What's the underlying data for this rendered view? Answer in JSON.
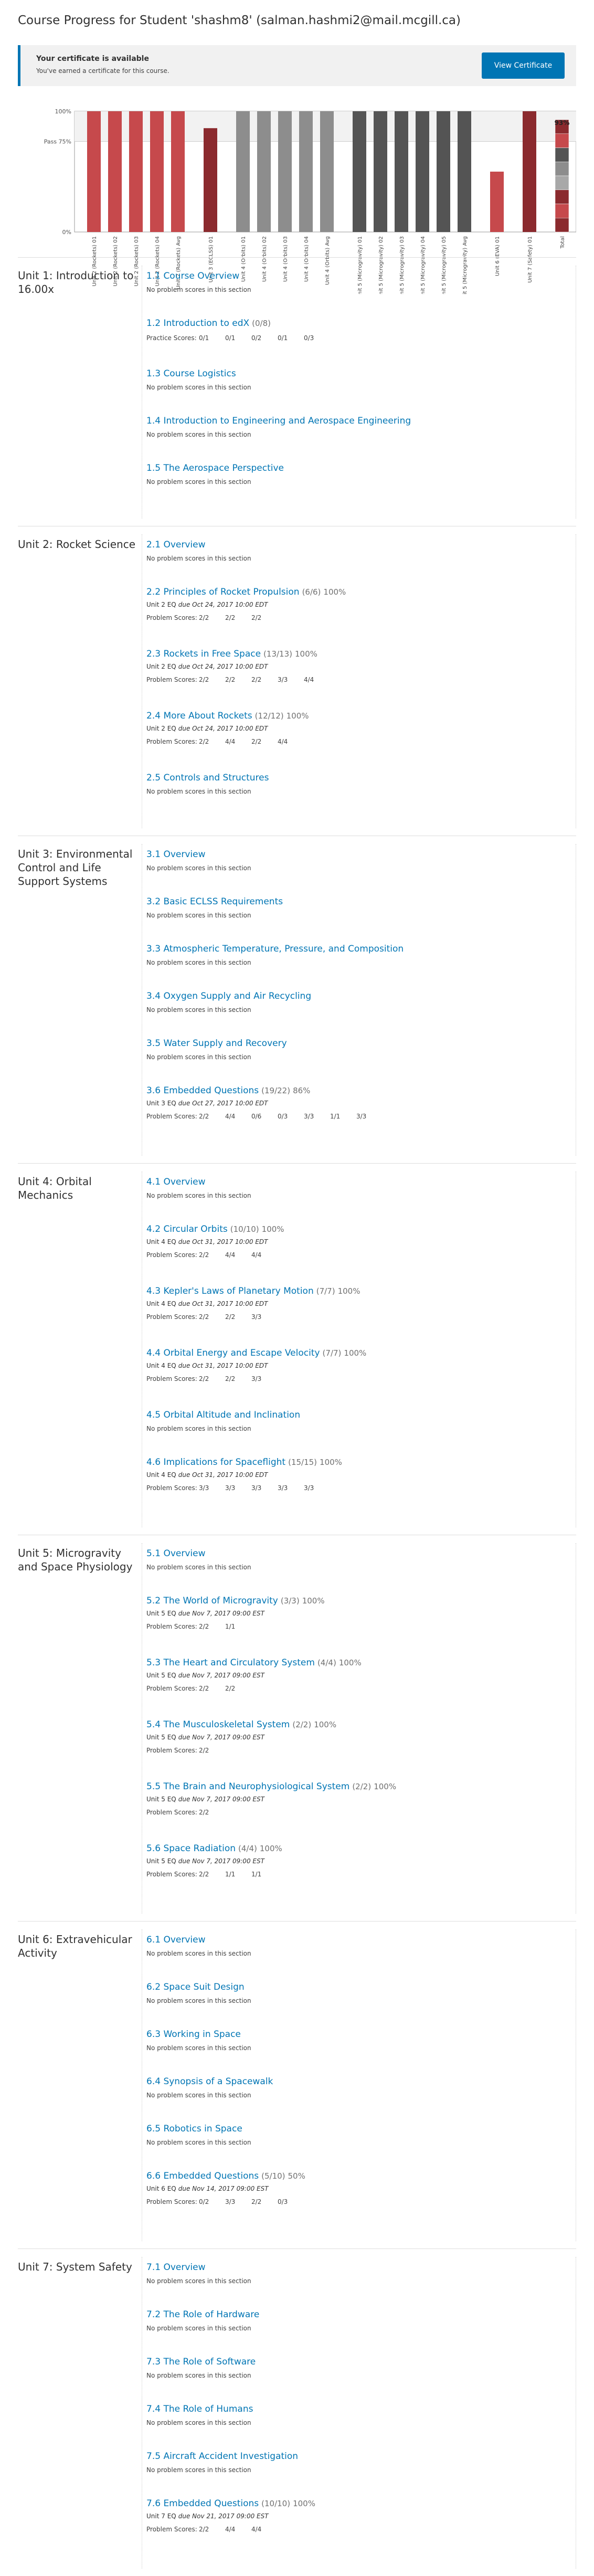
{
  "page": {
    "title": "Course Progress for Student 'shashm8' (salman.hashmi2@mail.mcgill.ca)",
    "cert_heading": "Your certificate is available",
    "cert_sub": "You've earned a certificate for this course.",
    "cert_button": "View Certificate"
  },
  "colors": {
    "accent": "#0075b4",
    "bar_unit1": "#c6494c",
    "bar_unit3": "#8d8d8d",
    "bar_unit5": "#545454",
    "bar_avg": "#8b2a2e"
  },
  "chart_data": {
    "type": "bar",
    "ylabels": [
      "100%",
      "Pass 75%",
      "0%"
    ],
    "ylim": [
      0,
      100
    ],
    "pass_mark": 75,
    "total_label": "93%",
    "categories": [
      "Unit 2 (Rockets) 01",
      "Unit 2 (Rockets) 02",
      "Unit 2 (Rockets) 03",
      "Unit 2 (Rockets) 04",
      "Unit 2 (Rockets) Avg",
      "Unit 3 (ECLSS) 01",
      "Unit 4 (Orbits) 01",
      "Unit 4 (Orbits) 02",
      "Unit 4 (Orbits) 03",
      "Unit 4 (Orbits) 04",
      "Unit 4 (Orbits) Avg",
      "Unit 5 (Microgravity) 01",
      "Unit 5 (Microgravity) 02",
      "Unit 5 (Microgravity) 03",
      "Unit 5 (Microgravity) 04",
      "Unit 5 (Microgravity) 05",
      "Unit 5 (Microgravity) Avg",
      "Unit 6 (EVA) 01",
      "Unit 7 (Safety) 01",
      "Total"
    ],
    "values": [
      100,
      100,
      100,
      100,
      100,
      86,
      100,
      100,
      100,
      100,
      100,
      100,
      100,
      100,
      100,
      100,
      100,
      50,
      100,
      93
    ],
    "bar_colors": [
      "#c6494c",
      "#c6494c",
      "#c6494c",
      "#c6494c",
      "#c6494c",
      "#8b2a2e",
      "#8d8d8d",
      "#8d8d8d",
      "#8d8d8d",
      "#8d8d8d",
      "#8d8d8d",
      "#545454",
      "#545454",
      "#545454",
      "#545454",
      "#545454",
      "#545454",
      "#c6494c",
      "#8b2a2e",
      "stack"
    ],
    "gap_after": [
      4,
      5,
      10,
      16,
      17,
      18
    ]
  },
  "sections": [
    {
      "unit": "Unit 1: Introduction to 16.00x",
      "subs": [
        {
          "title": "1.1 Course Overview",
          "score": "",
          "pct": "",
          "np": "No problem scores in this section"
        },
        {
          "title": "1.2 Introduction to edX",
          "score": "(0/8)",
          "pct": "",
          "label": "Practice Scores:",
          "scores": [
            "0/1",
            "0/1",
            "0/2",
            "0/1",
            "0/3"
          ]
        },
        {
          "title": "1.3 Course Logistics",
          "score": "",
          "pct": "",
          "np": "No problem scores in this section"
        },
        {
          "title": "1.4 Introduction to Engineering and Aerospace Engineering",
          "score": "",
          "pct": "",
          "np": "No problem scores in this section"
        },
        {
          "title": "1.5 The Aerospace Perspective",
          "score": "",
          "pct": "",
          "np": "No problem scores in this section"
        }
      ]
    },
    {
      "unit": "Unit 2: Rocket Science",
      "subs": [
        {
          "title": "2.1 Overview",
          "score": "",
          "pct": "",
          "np": "No problem scores in this section"
        },
        {
          "title": "2.2 Principles of Rocket Propulsion",
          "score": "(6/6)",
          "pct": "100%",
          "due_pre": "Unit 2 EQ",
          "due": "due Oct 24, 2017 10:00 EDT",
          "label": "Problem Scores:",
          "scores": [
            "2/2",
            "2/2",
            "2/2"
          ]
        },
        {
          "title": "2.3 Rockets in Free Space",
          "score": "(13/13)",
          "pct": "100%",
          "due_pre": "Unit 2 EQ",
          "due": "due Oct 24, 2017 10:00 EDT",
          "label": "Problem Scores:",
          "scores": [
            "2/2",
            "2/2",
            "2/2",
            "3/3",
            "4/4"
          ]
        },
        {
          "title": "2.4 More About Rockets",
          "score": "(12/12)",
          "pct": "100%",
          "due_pre": "Unit 2 EQ",
          "due": "due Oct 24, 2017 10:00 EDT",
          "label": "Problem Scores:",
          "scores": [
            "2/2",
            "4/4",
            "2/2",
            "4/4"
          ]
        },
        {
          "title": "2.5 Controls and Structures",
          "score": "",
          "pct": "",
          "np": "No problem scores in this section"
        }
      ]
    },
    {
      "unit": "Unit 3: Environmental Control and Life Support Systems",
      "subs": [
        {
          "title": "3.1 Overview",
          "score": "",
          "pct": "",
          "np": "No problem scores in this section"
        },
        {
          "title": "3.2 Basic ECLSS Requirements",
          "score": "",
          "pct": "",
          "np": "No problem scores in this section"
        },
        {
          "title": "3.3 Atmospheric Temperature, Pressure, and Composition",
          "score": "",
          "pct": "",
          "np": "No problem scores in this section"
        },
        {
          "title": "3.4 Oxygen Supply and Air Recycling",
          "score": "",
          "pct": "",
          "np": "No problem scores in this section"
        },
        {
          "title": "3.5 Water Supply and Recovery",
          "score": "",
          "pct": "",
          "np": "No problem scores in this section"
        },
        {
          "title": "3.6 Embedded Questions",
          "score": "(19/22)",
          "pct": "86%",
          "due_pre": "Unit 3 EQ",
          "due": "due Oct 27, 2017 10:00 EDT",
          "label": "Problem Scores:",
          "scores": [
            "2/2",
            "4/4",
            "0/6",
            "0/3",
            "3/3",
            "1/1",
            "3/3"
          ]
        }
      ]
    },
    {
      "unit": "Unit 4: Orbital Mechanics",
      "subs": [
        {
          "title": "4.1 Overview",
          "score": "",
          "pct": "",
          "np": "No problem scores in this section"
        },
        {
          "title": "4.2 Circular Orbits",
          "score": "(10/10)",
          "pct": "100%",
          "due_pre": "Unit 4 EQ",
          "due": "due Oct 31, 2017 10:00 EDT",
          "label": "Problem Scores:",
          "scores": [
            "2/2",
            "4/4",
            "4/4"
          ]
        },
        {
          "title": "4.3 Kepler's Laws of Planetary Motion",
          "score": "(7/7)",
          "pct": "100%",
          "due_pre": "Unit 4 EQ",
          "due": "due Oct 31, 2017 10:00 EDT",
          "label": "Problem Scores:",
          "scores": [
            "2/2",
            "2/2",
            "3/3"
          ]
        },
        {
          "title": "4.4 Orbital Energy and Escape Velocity",
          "score": "(7/7)",
          "pct": "100%",
          "due_pre": "Unit 4 EQ",
          "due": "due Oct 31, 2017 10:00 EDT",
          "label": "Problem Scores:",
          "scores": [
            "2/2",
            "2/2",
            "3/3"
          ]
        },
        {
          "title": "4.5 Orbital Altitude and Inclination",
          "score": "",
          "pct": "",
          "np": "No problem scores in this section"
        },
        {
          "title": "4.6 Implications for Spaceflight",
          "score": "(15/15)",
          "pct": "100%",
          "due_pre": "Unit 4 EQ",
          "due": "due Oct 31, 2017 10:00 EDT",
          "label": "Problem Scores:",
          "scores": [
            "3/3",
            "3/3",
            "3/3",
            "3/3",
            "3/3"
          ]
        }
      ]
    },
    {
      "unit": "Unit 5: Microgravity and Space Physiology",
      "subs": [
        {
          "title": "5.1 Overview",
          "score": "",
          "pct": "",
          "np": "No problem scores in this section"
        },
        {
          "title": "5.2 The World of Microgravity",
          "score": "(3/3)",
          "pct": "100%",
          "due_pre": "Unit 5 EQ",
          "due": "due Nov 7, 2017 09:00 EST",
          "label": "Problem Scores:",
          "scores": [
            "2/2",
            "1/1"
          ]
        },
        {
          "title": "5.3 The Heart and Circulatory System",
          "score": "(4/4)",
          "pct": "100%",
          "due_pre": "Unit 5 EQ",
          "due": "due Nov 7, 2017 09:00 EST",
          "label": "Problem Scores:",
          "scores": [
            "2/2",
            "2/2"
          ]
        },
        {
          "title": "5.4 The Musculoskeletal System",
          "score": "(2/2)",
          "pct": "100%",
          "due_pre": "Unit 5 EQ",
          "due": "due Nov 7, 2017 09:00 EST",
          "label": "Problem Scores:",
          "scores": [
            "2/2"
          ]
        },
        {
          "title": "5.5 The Brain and Neurophysiological System",
          "score": "(2/2)",
          "pct": "100%",
          "due_pre": "Unit 5 EQ",
          "due": "due Nov 7, 2017 09:00 EST",
          "label": "Problem Scores:",
          "scores": [
            "2/2"
          ]
        },
        {
          "title": "5.6 Space Radiation",
          "score": "(4/4)",
          "pct": "100%",
          "due_pre": "Unit 5 EQ",
          "due": "due Nov 7, 2017 09:00 EST",
          "label": "Problem Scores:",
          "scores": [
            "2/2",
            "1/1",
            "1/1"
          ]
        }
      ]
    },
    {
      "unit": "Unit 6: Extravehicular Activity",
      "subs": [
        {
          "title": "6.1 Overview",
          "score": "",
          "pct": "",
          "np": "No problem scores in this section"
        },
        {
          "title": "6.2 Space Suit Design",
          "score": "",
          "pct": "",
          "np": "No problem scores in this section"
        },
        {
          "title": "6.3 Working in Space",
          "score": "",
          "pct": "",
          "np": "No problem scores in this section"
        },
        {
          "title": "6.4 Synopsis of a Spacewalk",
          "score": "",
          "pct": "",
          "np": "No problem scores in this section"
        },
        {
          "title": "6.5 Robotics in Space",
          "score": "",
          "pct": "",
          "np": "No problem scores in this section"
        },
        {
          "title": "6.6 Embedded Questions",
          "score": "(5/10)",
          "pct": "50%",
          "due_pre": "Unit 6 EQ",
          "due": "due Nov 14, 2017 09:00 EST",
          "label": "Problem Scores:",
          "scores": [
            "0/2",
            "3/3",
            "2/2",
            "0/3"
          ]
        }
      ]
    },
    {
      "unit": "Unit 7: System Safety",
      "subs": [
        {
          "title": "7.1 Overview",
          "score": "",
          "pct": "",
          "np": "No problem scores in this section"
        },
        {
          "title": "7.2 The Role of Hardware",
          "score": "",
          "pct": "",
          "np": "No problem scores in this section"
        },
        {
          "title": "7.3 The Role of Software",
          "score": "",
          "pct": "",
          "np": "No problem scores in this section"
        },
        {
          "title": "7.4 The Role of Humans",
          "score": "",
          "pct": "",
          "np": "No problem scores in this section"
        },
        {
          "title": "7.5 Aircraft Accident Investigation",
          "score": "",
          "pct": "",
          "np": "No problem scores in this section"
        },
        {
          "title": "7.6 Embedded Questions",
          "score": "(10/10)",
          "pct": "100%",
          "due_pre": "Unit 7 EQ",
          "due": "due Nov 21, 2017 09:00 EST",
          "label": "Problem Scores:",
          "scores": [
            "2/2",
            "4/4",
            "4/4"
          ]
        }
      ]
    }
  ]
}
